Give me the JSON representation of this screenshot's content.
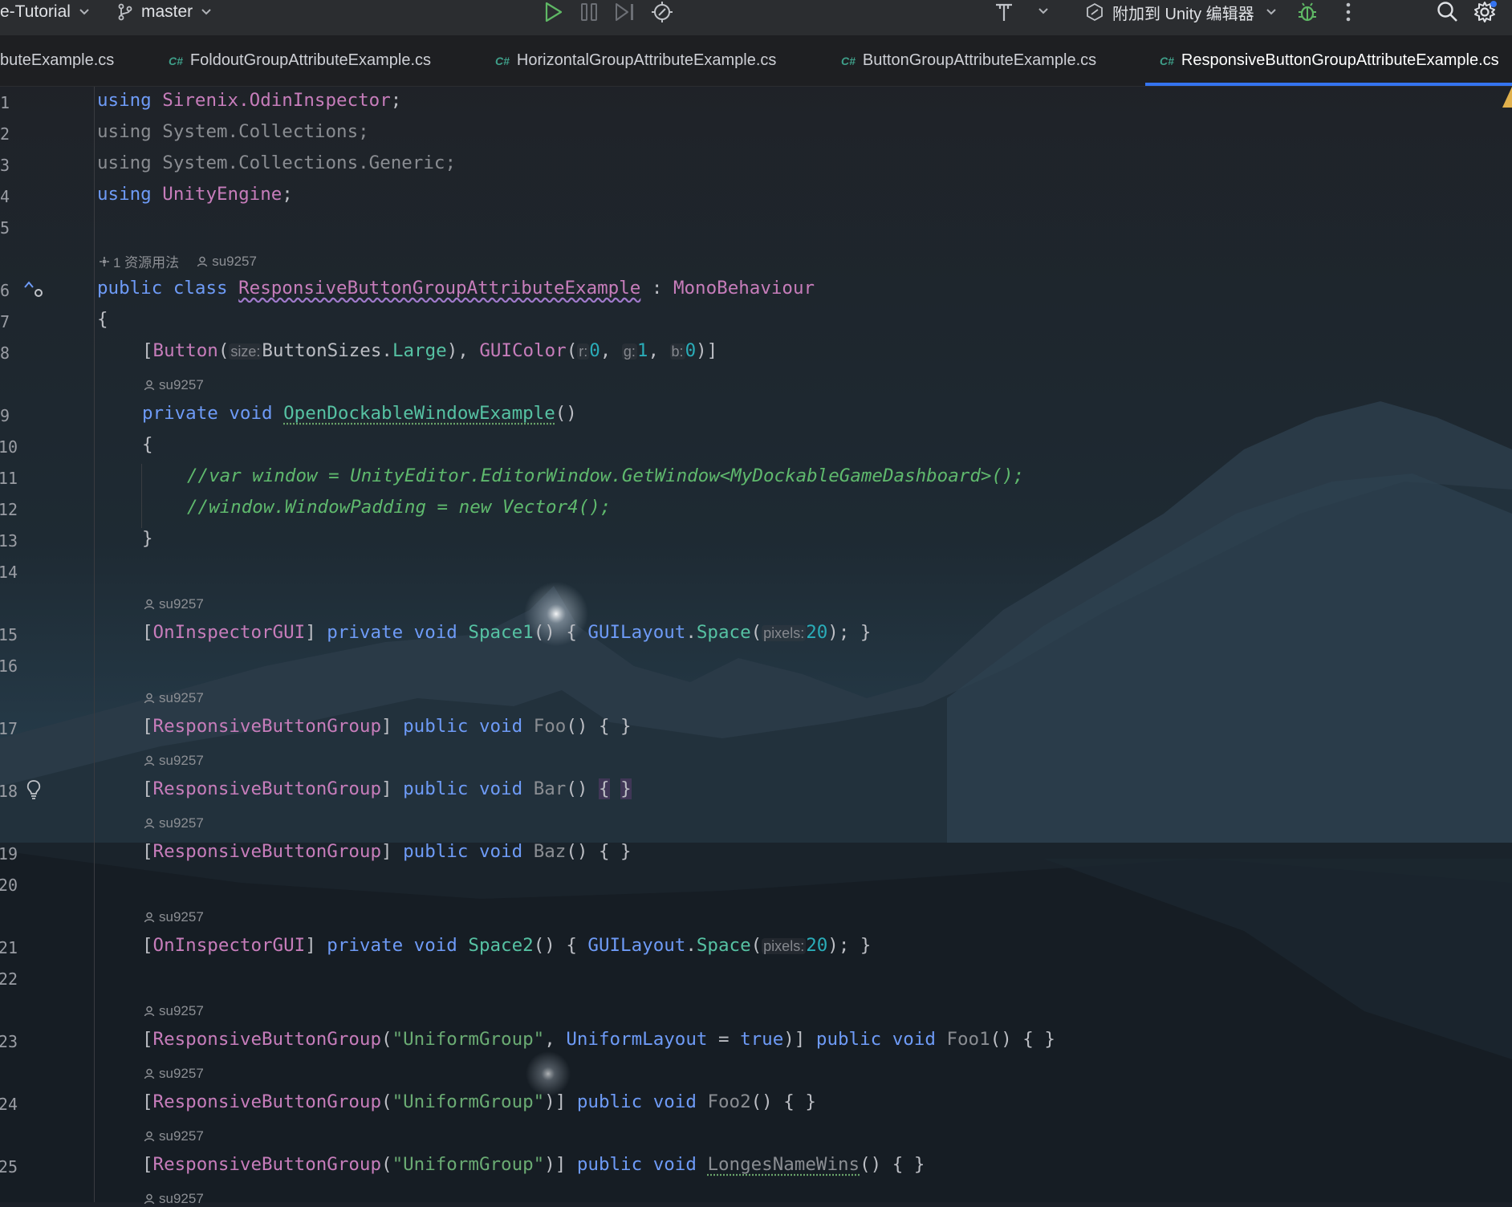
{
  "titlebar": {
    "project": "e-Tutorial",
    "branch": "master",
    "attach_label": "附加到 Unity 编辑器"
  },
  "tabs": [
    {
      "label": "buteExample.cs",
      "has_icon": false
    },
    {
      "label": "FoldoutGroupAttributeExample.cs",
      "has_icon": true
    },
    {
      "label": "HorizontalGroupAttributeExample.cs",
      "has_icon": true
    },
    {
      "label": "ButtonGroupAttributeExample.cs",
      "has_icon": true
    },
    {
      "label": "ResponsiveButtonGroupAttributeExample.cs",
      "has_icon": true,
      "active": true
    }
  ],
  "tab_icon_text": "C#",
  "line_numbers": [
    "1",
    "2",
    "3",
    "4",
    "5",
    "6",
    "7",
    "8",
    "9",
    "10",
    "11",
    "12",
    "13",
    "14",
    "15",
    "16",
    "17",
    "18",
    "19",
    "20",
    "21",
    "22",
    "23",
    "24",
    "25"
  ],
  "code": {
    "using": "using",
    "ns1": "Sirenix.OdinInspector",
    "ns2": "System.Collections",
    "ns3": "System.Collections.Generic",
    "ns4": "UnityEngine",
    "semi": ";",
    "public": "public",
    "class": "class",
    "private": "private",
    "void": "void",
    "new": "new",
    "true": "true",
    "class_name": "ResponsiveButtonGroupAttributeExample",
    "base_class": "MonoBehaviour",
    "colon": " : ",
    "lbrace": "{",
    "rbrace": "}",
    "button_attr": "Button",
    "button_sizes": "ButtonSizes",
    "large": "Large",
    "guicolor": "GUIColor",
    "zero": "0",
    "one": "1",
    "twenty": "20",
    "open_fn": "OpenDockableWindowExample",
    "comment1": "//var window = UnityEditor.EditorWindow.GetWindow<MyDockableGameDashboard>();",
    "comment2": "//window.WindowPadding = new Vector4();",
    "on_inspector": "OnInspectorGUI",
    "space1": "Space1",
    "space2": "Space2",
    "guilayout": "GUILayout",
    "space": "Space",
    "rbg": "ResponsiveButtonGroup",
    "foo": "Foo",
    "bar": "Bar",
    "baz": "Baz",
    "foo1": "Foo1",
    "foo2": "Foo2",
    "longes": "LongesNameWins",
    "uniform_str": "\"UniformGroup\"",
    "uniform_layout": "UniformLayout"
  },
  "hints": {
    "size": "size:",
    "r": "r:",
    "g": "g:",
    "b": "b:",
    "pixels": "pixels:"
  },
  "meta": {
    "usages": "1 资源用法",
    "author": "su9257"
  },
  "colors": {
    "keyword": "#6e9bf7",
    "type": "#c77dbb",
    "function": "#56c2a3",
    "number": "#2aacb8",
    "string": "#6aab73",
    "comment": "#5fb96d",
    "accent": "#3574f0"
  }
}
